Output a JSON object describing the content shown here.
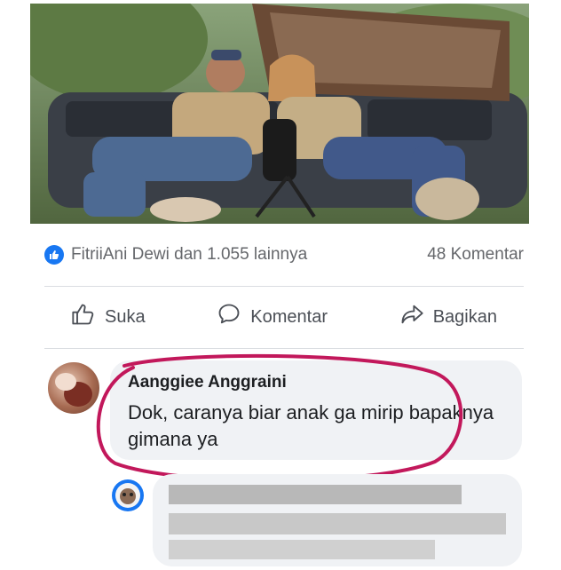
{
  "post": {
    "image_alt_description": ""
  },
  "reactions": {
    "summary": "FitriiAni Dewi dan 1.055 lainnya",
    "comments": "48 Komentar"
  },
  "actions": {
    "like": "Suka",
    "comment": "Komentar",
    "share": "Bagikan"
  },
  "comment": {
    "author": "Aanggiee Anggraini",
    "text": "Dok, caranya biar anak ga mirip bapaknya gimana ya"
  },
  "colors": {
    "facebook_blue": "#1877f2",
    "annotation_red": "#c2185b",
    "bubble_bg": "#f0f2f5"
  }
}
